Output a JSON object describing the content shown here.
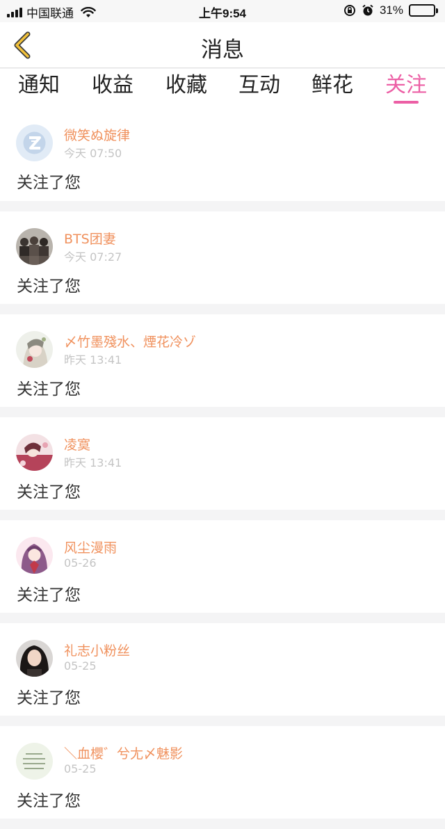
{
  "status_bar": {
    "carrier": "中国联通",
    "time": "上午9:54",
    "battery_percent": "31%",
    "battery_level": 0.31
  },
  "nav": {
    "title": "消息",
    "back_icon": "chevron-left-icon",
    "back_color": "#f3c23a"
  },
  "tabs": [
    {
      "label": "通知",
      "active": false
    },
    {
      "label": "收益",
      "active": false
    },
    {
      "label": "收藏",
      "active": false
    },
    {
      "label": "互动",
      "active": false
    },
    {
      "label": "鲜花",
      "active": false
    },
    {
      "label": "关注",
      "active": true
    }
  ],
  "colors": {
    "accent": "#ec5fa5",
    "username": "#f0915d",
    "timestamp": "#c4c4c4"
  },
  "messages": [
    {
      "username": "微笑ぬ旋律",
      "time": "今天 07:50",
      "text": "关注了您"
    },
    {
      "username": "BTS团妻",
      "time": "今天 07:27",
      "text": "关注了您"
    },
    {
      "username": "〆竹墨殘水、煙花冷ゾ",
      "time": "昨天 13:41",
      "text": "关注了您"
    },
    {
      "username": "凌寞",
      "time": "昨天 13:41",
      "text": "关注了您"
    },
    {
      "username": "风尘漫雨",
      "time": "05-26",
      "text": "关注了您"
    },
    {
      "username": "礼志小粉丝",
      "time": "05-25",
      "text": "关注了您"
    },
    {
      "username": "＼血櫻゛兮尢〆魅影",
      "time": "05-25",
      "text": "关注了您"
    }
  ]
}
